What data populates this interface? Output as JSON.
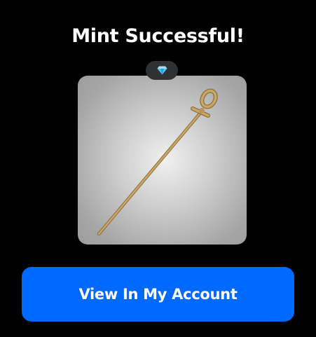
{
  "modal": {
    "title": "Mint Successful!",
    "badge": {
      "icon": "diamond-icon",
      "color": "#4fc3f7"
    },
    "item": {
      "icon": "ankh-staff-image",
      "card_gradient": [
        "#f0f0f0",
        "#9c9c9c"
      ]
    },
    "button": {
      "label": "View In My Account",
      "color": "#0069ff"
    }
  }
}
